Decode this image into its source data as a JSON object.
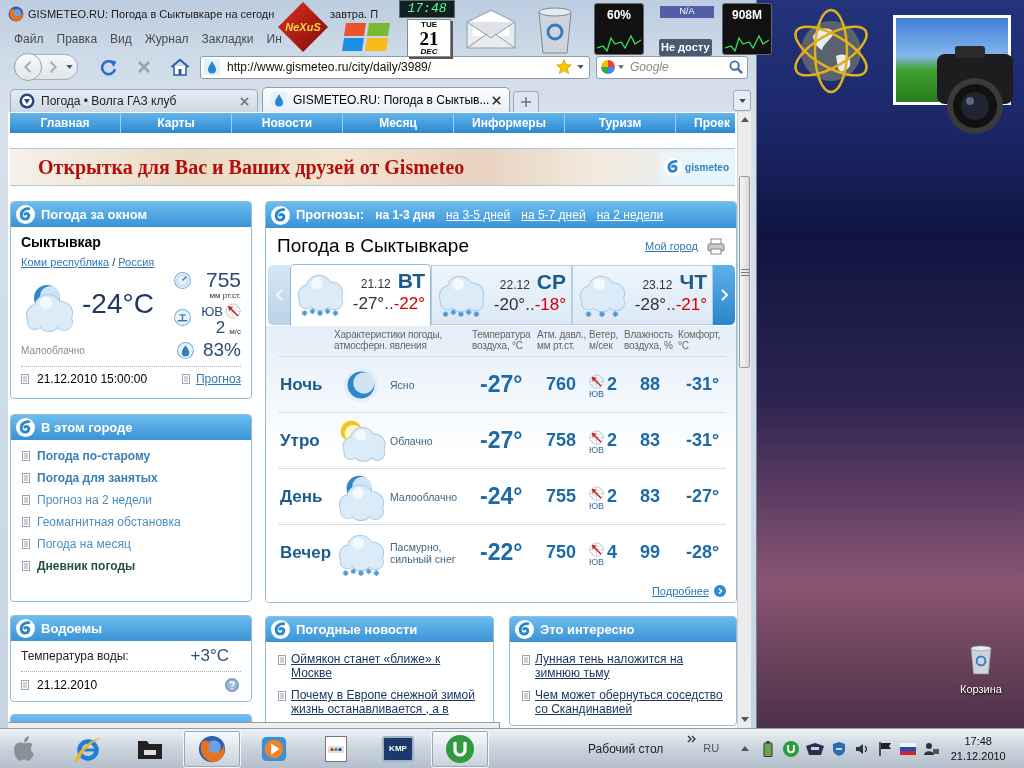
{
  "gadgets": {
    "logo_text": "NeXuS",
    "clock": "17:48",
    "calendar": {
      "weekday": "TUE",
      "day": "21",
      "month": "DEC"
    },
    "cpu": "60%",
    "network_badge": "N/A",
    "network_status": "Не досту",
    "memory": "908M"
  },
  "browser": {
    "title_parts": [
      "GISMETEO.RU: Погода в Сыктывкаре на сегодн",
      "завтра. П"
    ],
    "menu": [
      "Файл",
      "Правка",
      "Вид",
      "Журнал",
      "Закладки",
      "Ин"
    ],
    "url": "http://www.gismeteo.ru/city/daily/3989/",
    "search": {
      "placeholder": "Google"
    },
    "tabs": [
      {
        "label": "Погода • Волга ГАЗ клуб",
        "selected": false
      },
      {
        "label": "GISMETEO.RU: Погода в Сыктыв...",
        "selected": true
      }
    ]
  },
  "page": {
    "nav": [
      "Главная",
      "Карты",
      "Новости",
      "Месяц",
      "Информеры",
      "Туризм",
      "Проек"
    ],
    "banner": {
      "text": "Открытка для Вас и Ваших друзей от Gismeteo",
      "logo": "gismeteo"
    },
    "now": {
      "title": "Погода за окном",
      "city": "Сыктывкар",
      "region": "Коми республика",
      "separator": "/",
      "country": "Россия",
      "kind": "partly_cloudy",
      "temperature": "-24°C",
      "condition": "Малооблачно",
      "pressure": "755",
      "pressure_unit": "мм рт.ст.",
      "wind_direction": "ЮВ",
      "wind_speed": "2",
      "wind_unit": "м/с",
      "humidity": "83%",
      "updated": "21.12.2010 15:00:00",
      "forecast_link": "Прогноз"
    },
    "city_links": {
      "title": "В этом городе",
      "items": [
        {
          "label": "Погода по-старому",
          "kind": "bold"
        },
        {
          "label": "Погода для занятых",
          "kind": "bold"
        },
        {
          "label": "Прогноз на 2 недели",
          "kind": "plain"
        },
        {
          "label": "Геомагнитная обстановка",
          "kind": "plain"
        },
        {
          "label": "Погода на месяц",
          "kind": "plain"
        },
        {
          "label": "Дневник погоды",
          "kind": "current"
        }
      ]
    },
    "water": {
      "title": "Водоемы",
      "label": "Температура воды:",
      "value": "+3°C",
      "date": "21.12.2010"
    },
    "forecast": {
      "label": "Прогнозы:",
      "periods": [
        {
          "label": "на 1-3 дня",
          "selected": true
        },
        {
          "label": "на 3-5 дней",
          "selected": false
        },
        {
          "label": "на 5-7 дней",
          "selected": false
        },
        {
          "label": "на 2 недели",
          "selected": false
        }
      ],
      "title": "Погода в Сыктывкаре",
      "my_city": "Мой город",
      "prev_enabled": false,
      "next_enabled": true,
      "days": [
        {
          "date": "21.12",
          "weekday": "ВТ",
          "low": "-27°..",
          "high": "-22°",
          "kind": "heavy_snow",
          "selected": true
        },
        {
          "date": "22.12",
          "weekday": "СР",
          "low": "-20°..",
          "high": "-18°",
          "kind": "heavy_snow",
          "selected": false
        },
        {
          "date": "23.12",
          "weekday": "ЧТ",
          "low": "-28°..",
          "high": "-21°",
          "kind": "snow",
          "selected": false
        }
      ],
      "columns": [
        "Характеристики погоды, атмосферн. явления",
        "Температура воздуха, °C",
        "Атм. давл., мм рт.ст.",
        "Ветер, м/сек",
        "Влажность воздуха, %",
        "Комфорт, °C"
      ],
      "rows": [
        {
          "time": "Ночь",
          "kind": "clear_night",
          "condition": "Ясно",
          "temperature": "-27°",
          "pressure": "760",
          "wind_direction": "ЮВ",
          "wind_speed": "2",
          "humidity": "88",
          "comfort": "-31°"
        },
        {
          "time": "Утро",
          "kind": "cloudy",
          "condition": "Облачно",
          "temperature": "-27°",
          "pressure": "758",
          "wind_direction": "ЮВ",
          "wind_speed": "2",
          "humidity": "83",
          "comfort": "-31°"
        },
        {
          "time": "День",
          "kind": "partly_cloudy",
          "condition": "Малооблачно",
          "temperature": "-24°",
          "pressure": "755",
          "wind_direction": "ЮВ",
          "wind_speed": "2",
          "humidity": "83",
          "comfort": "-27°"
        },
        {
          "time": "Вечер",
          "kind": "heavy_snow",
          "condition": "Пасмурно, сильный снег",
          "temperature": "-22°",
          "pressure": "750",
          "wind_direction": "ЮВ",
          "wind_speed": "4",
          "humidity": "99",
          "comfort": "-28°"
        }
      ],
      "more": "Подробнее"
    },
    "news": {
      "title": "Погодные новости",
      "items": [
        "Оймякон станет «ближе» к Москве",
        "Почему в Европе снежной зимой жизнь останавливается , а в"
      ]
    },
    "interesting": {
      "title": "Это интересно",
      "items": [
        "Лунная тень наложится на зимнюю тьму",
        "Чем может обернуться соседство со Скандинавией"
      ]
    }
  },
  "desktop": {
    "icons": [
      {
        "label": "Корзина"
      }
    ]
  },
  "taskbar": {
    "apps": [
      {
        "kind": "ie",
        "running": false
      },
      {
        "kind": "explorer",
        "running": false
      },
      {
        "kind": "firefox",
        "running": true
      },
      {
        "kind": "media",
        "running": false
      },
      {
        "kind": "document",
        "running": false
      },
      {
        "kind": "kmp",
        "label": "KMP",
        "running": false
      },
      {
        "kind": "torrent",
        "running": true
      }
    ],
    "toolbar_label": "Рабочий стол",
    "language": "RU",
    "clock": {
      "time": "17:48",
      "date": "21.12.2010"
    }
  }
}
